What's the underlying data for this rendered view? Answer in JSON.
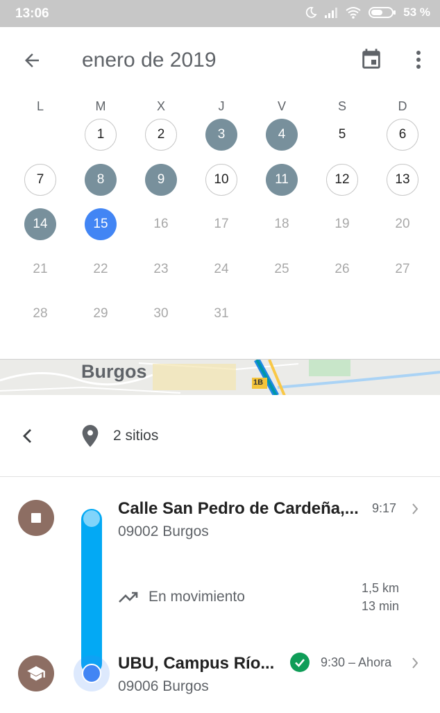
{
  "status_bar": {
    "time": "13:06",
    "battery": "53 %",
    "icons": [
      "moon-icon",
      "signal-icon",
      "wifi-icon",
      "battery-icon"
    ]
  },
  "calendar": {
    "month_title": "enero de 2019",
    "weekdays": [
      "L",
      "M",
      "X",
      "J",
      "V",
      "S",
      "D"
    ],
    "days": [
      {
        "label": "1",
        "state": "outlined"
      },
      {
        "label": "2",
        "state": "outlined"
      },
      {
        "label": "3",
        "state": "filled"
      },
      {
        "label": "4",
        "state": "filled"
      },
      {
        "label": "5",
        "state": "plain"
      },
      {
        "label": "6",
        "state": "outlined"
      },
      {
        "label": "7",
        "state": "outlined"
      },
      {
        "label": "8",
        "state": "filled"
      },
      {
        "label": "9",
        "state": "filled"
      },
      {
        "label": "10",
        "state": "outlined"
      },
      {
        "label": "11",
        "state": "filled"
      },
      {
        "label": "12",
        "state": "outlined"
      },
      {
        "label": "13",
        "state": "outlined"
      },
      {
        "label": "14",
        "state": "filled"
      },
      {
        "label": "15",
        "state": "today"
      },
      {
        "label": "16",
        "state": "future"
      },
      {
        "label": "17",
        "state": "future"
      },
      {
        "label": "18",
        "state": "future"
      },
      {
        "label": "19",
        "state": "future"
      },
      {
        "label": "20",
        "state": "future"
      },
      {
        "label": "21",
        "state": "future"
      },
      {
        "label": "22",
        "state": "future"
      },
      {
        "label": "23",
        "state": "future"
      },
      {
        "label": "24",
        "state": "future"
      },
      {
        "label": "25",
        "state": "future"
      },
      {
        "label": "26",
        "state": "future"
      },
      {
        "label": "27",
        "state": "future"
      },
      {
        "label": "28",
        "state": "future"
      },
      {
        "label": "29",
        "state": "future"
      },
      {
        "label": "30",
        "state": "future"
      },
      {
        "label": "31",
        "state": "future"
      }
    ],
    "colors": {
      "today": "#4285f4",
      "visited": "#78909c"
    }
  },
  "map": {
    "city_label": "Burgos",
    "road_label": "1B"
  },
  "day_nav": {
    "places_label": "2 sitios"
  },
  "timeline": {
    "place1": {
      "title": "Calle San Pedro de Cardeña,...",
      "address": "09002 Burgos",
      "time": "9:17",
      "icon": "stop-icon"
    },
    "movement": {
      "label": "En movimiento",
      "distance": "1,5 km",
      "duration": "13 min",
      "icon": "trending-icon"
    },
    "place2": {
      "title": "UBU, Campus Río...",
      "address": "09006 Burgos",
      "time": "9:30 – Ahora",
      "icon": "school-icon"
    },
    "colors": {
      "track": "#03a9f4",
      "place_icon": "#8d6e63",
      "check": "#0f9d58"
    }
  }
}
